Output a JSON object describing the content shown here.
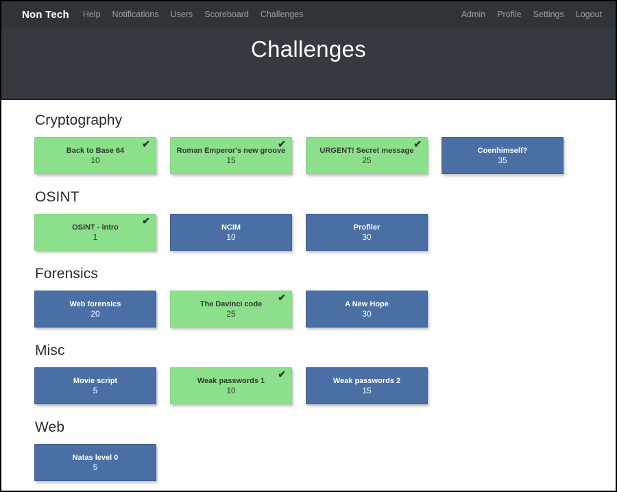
{
  "navbar": {
    "brand": "Non Tech",
    "left_links": [
      {
        "label": "Help"
      },
      {
        "label": "Notifications"
      },
      {
        "label": "Users"
      },
      {
        "label": "Scoreboard"
      },
      {
        "label": "Challenges"
      }
    ],
    "right_links": [
      {
        "label": "Admin"
      },
      {
        "label": "Profile"
      },
      {
        "label": "Settings"
      },
      {
        "label": "Logout"
      }
    ]
  },
  "hero": {
    "title": "Challenges"
  },
  "colors": {
    "navbar_bg": "#2f3439",
    "hero_bg": "#343a40",
    "solved_card": "#8ce08c",
    "unsolved_card": "#4a6fa5",
    "page_bg": "#fdfdfb",
    "heading_text": "#2b2b2b"
  },
  "icons": {
    "solved_check": "✔"
  },
  "categories": [
    {
      "name": "Cryptography",
      "challenges": [
        {
          "title": "Back to Base 64",
          "points": "10",
          "solved": true
        },
        {
          "title": "Roman Emperor's new groove",
          "points": "15",
          "solved": true
        },
        {
          "title": "URGENT! Secret message",
          "points": "25",
          "solved": true
        },
        {
          "title": "Coenhimself?",
          "points": "35",
          "solved": false
        }
      ]
    },
    {
      "name": "OSINT",
      "challenges": [
        {
          "title": "OSINT - intro",
          "points": "1",
          "solved": true
        },
        {
          "title": "NCIM",
          "points": "10",
          "solved": false
        },
        {
          "title": "Profiler",
          "points": "30",
          "solved": false
        }
      ]
    },
    {
      "name": "Forensics",
      "challenges": [
        {
          "title": "Web forensics",
          "points": "20",
          "solved": false
        },
        {
          "title": "The Davinci code",
          "points": "25",
          "solved": true
        },
        {
          "title": "A New Hope",
          "points": "30",
          "solved": false
        }
      ]
    },
    {
      "name": "Misc",
      "challenges": [
        {
          "title": "Movie script",
          "points": "5",
          "solved": false
        },
        {
          "title": "Weak passwords 1",
          "points": "10",
          "solved": true
        },
        {
          "title": "Weak passwords 2",
          "points": "15",
          "solved": false
        }
      ]
    },
    {
      "name": "Web",
      "challenges": [
        {
          "title": "Natas level 0",
          "points": "5",
          "solved": false
        }
      ]
    }
  ]
}
